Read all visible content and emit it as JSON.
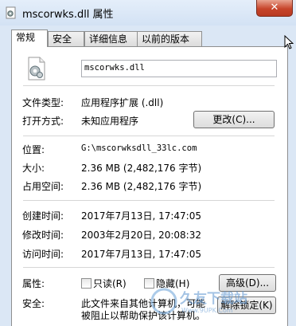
{
  "window": {
    "title": "mscorwks.dll 属性",
    "close_symbol": "✕"
  },
  "tabs": [
    {
      "label": "常规",
      "active": true
    },
    {
      "label": "安全",
      "active": false
    },
    {
      "label": "详细信息",
      "active": false
    },
    {
      "label": "以前的版本",
      "active": false
    }
  ],
  "general": {
    "file_name": "mscorwks.dll",
    "file_type_label": "文件类型:",
    "file_type_value": "应用程序扩展 (.dll)",
    "open_with_label": "打开方式:",
    "open_with_value": "未知应用程序",
    "change_button": "更改(C)...",
    "location_label": "位置:",
    "location_value": "G:\\mscorwksdll_33lc.com",
    "size_label": "大小:",
    "size_value": "2.36 MB (2,482,176 字节)",
    "size_on_disk_label": "占用空间:",
    "size_on_disk_value": "2.36 MB (2,482,176 字节)",
    "created_label": "创建时间:",
    "created_value": "2017年7月13日, 17:47:05",
    "modified_label": "修改时间:",
    "modified_value": "2003年2月20日, 20:08:32",
    "accessed_label": "访问时间:",
    "accessed_value": "2017年7月13日, 17:47:05",
    "attributes_label": "属性:",
    "readonly_label": "只读(R)",
    "hidden_label": "隐藏(H)",
    "advanced_button": "高级(D)...",
    "security_label": "安全:",
    "security_text_1": "此文件来自其他计算机，可能",
    "security_text_2": "被阻止以帮助保护该计算机。",
    "unblock_button": "解除锁定(K)"
  },
  "watermark": {
    "text": "久友下载站",
    "sub": "Www.9UPK.Com"
  }
}
